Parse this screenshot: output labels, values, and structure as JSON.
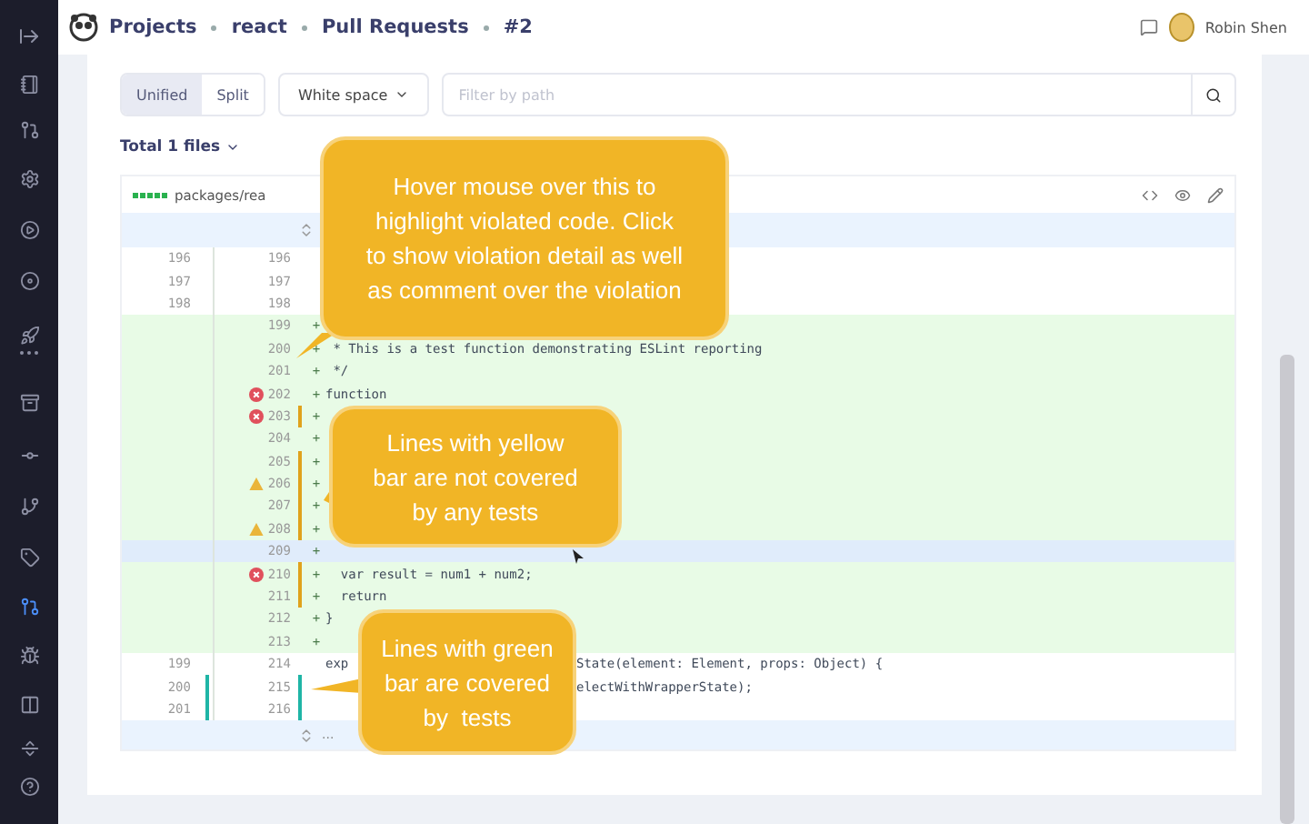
{
  "sidebar": {
    "items": [
      {
        "selected": false
      },
      {
        "selected": false
      },
      {
        "selected": false
      },
      {
        "selected": false
      },
      {
        "selected": false
      },
      {
        "selected": false
      },
      {
        "selected": false
      },
      {
        "selected": false
      },
      {
        "selected": false
      },
      {
        "selected": false
      },
      {
        "selected": true
      },
      {
        "selected": false
      },
      {
        "selected": false
      },
      {
        "selected": false
      },
      {
        "selected": false
      }
    ]
  },
  "breadcrumbs": [
    "Projects",
    "react",
    "Pull Requests",
    "#2"
  ],
  "user": {
    "name": "Robin Shen"
  },
  "toolbar": {
    "view_modes": [
      {
        "label": "Unified",
        "selected": true
      },
      {
        "label": "Split",
        "selected": false
      }
    ],
    "whitespace": "White space",
    "filter": {
      "placeholder": "Filter by path"
    }
  },
  "total_files": "Total 1 files",
  "file": {
    "path": "packages/rea",
    "rows": [
      {
        "kind": "context",
        "old": "196",
        "new": "196"
      },
      {
        "kind": "context",
        "old": "197",
        "new": "197"
      },
      {
        "kind": "context",
        "old": "198",
        "new": "198"
      },
      {
        "kind": "added",
        "new": "199",
        "marker": "+"
      },
      {
        "kind": "added",
        "new": "200",
        "marker": "+",
        "code": " * This is a test function demonstrating ESLint reporting"
      },
      {
        "kind": "added",
        "new": "201",
        "marker": "+",
        "code": " */"
      },
      {
        "kind": "added",
        "new": "202",
        "marker": "+",
        "code": "function",
        "error": true
      },
      {
        "kind": "added",
        "new": "203",
        "marker": "+",
        "error": true,
        "coverage": {
          "color": "#e0a21c"
        }
      },
      {
        "kind": "added",
        "new": "204",
        "marker": "+"
      },
      {
        "kind": "added",
        "new": "205",
        "marker": "+",
        "coverage": {
          "color": "#e0a21c"
        }
      },
      {
        "kind": "added",
        "new": "206",
        "marker": "+",
        "warning": true,
        "coverage": {
          "color": "#e0a21c"
        }
      },
      {
        "kind": "added",
        "new": "207",
        "marker": "+",
        "coverage": {
          "color": "#e0a21c"
        }
      },
      {
        "kind": "added",
        "new": "208",
        "marker": "+",
        "warning": true,
        "coverage": {
          "color": "#e0a21c"
        }
      },
      {
        "kind": "added",
        "new": "209",
        "marker": "+",
        "highlighted": true
      },
      {
        "kind": "added",
        "new": "210",
        "marker": "+",
        "code": "  var result = num1 + num2;",
        "error": true,
        "coverage": {
          "color": "#e0a21c"
        }
      },
      {
        "kind": "added",
        "new": "211",
        "marker": "+",
        "code": "  return",
        "coverage": {
          "color": "#e0a21c"
        }
      },
      {
        "kind": "added",
        "new": "212",
        "marker": "+",
        "code": "}"
      },
      {
        "kind": "added",
        "new": "213",
        "marker": "+"
      },
      {
        "kind": "context",
        "old": "199",
        "new": "214",
        "code": "exp",
        "code_after": "State(element: Element, props: Object) {"
      },
      {
        "kind": "context",
        "old": "200",
        "new": "215",
        "code_after": "electWithWrapperState);",
        "coverage": {
          "color": "#1fb5a6"
        },
        "old_coverage": {
          "color": "#1fb5a6"
        }
      },
      {
        "kind": "context",
        "old": "201",
        "new": "216",
        "coverage": {
          "color": "#1fb5a6"
        },
        "old_coverage": {
          "color": "#1fb5a6"
        }
      }
    ],
    "footer": "..."
  },
  "callouts": [
    {
      "text": "Hover mouse over this to\nhighlight violated code. Click\nto show violation detail as well\nas comment over the violation"
    },
    {
      "text": "Lines with yellow\nbar are not covered\nby any tests"
    },
    {
      "text": "Lines with green\nbar are covered\nby  tests"
    }
  ]
}
